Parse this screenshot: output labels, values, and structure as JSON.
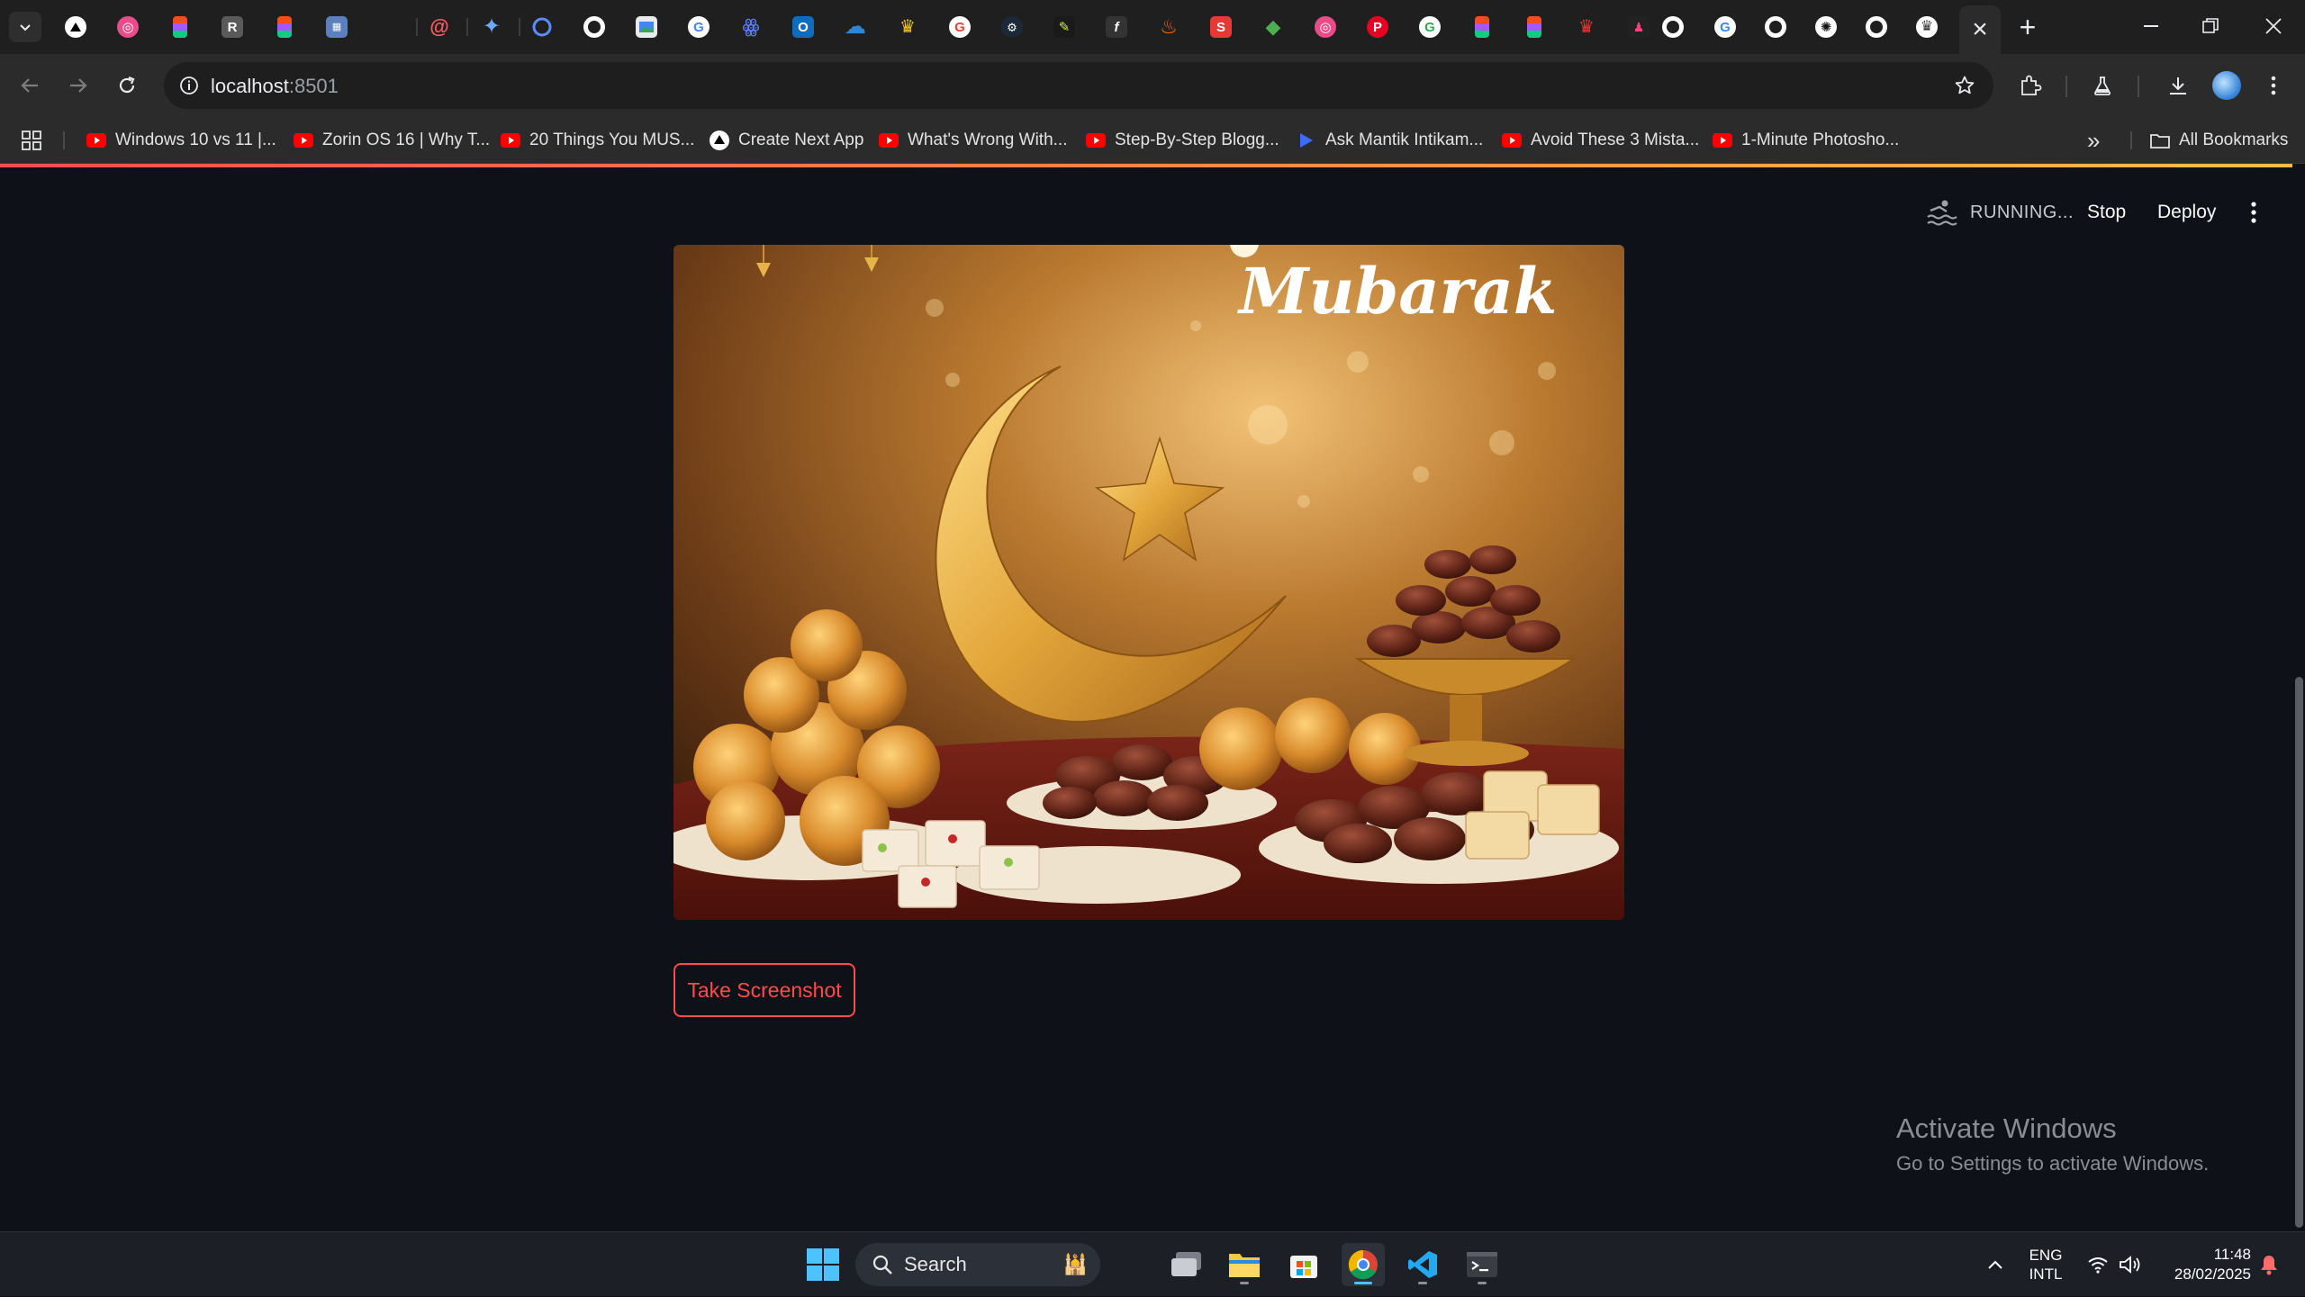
{
  "browser": {
    "active_tab_close": "×",
    "new_tab": "+",
    "url_host": "localhost",
    "url_port": ":8501"
  },
  "bookmarks": [
    {
      "label": "Windows 10 vs 11 |...",
      "icon": "youtube-icon"
    },
    {
      "label": "Zorin OS 16 | Why T...",
      "icon": "youtube-icon"
    },
    {
      "label": "20 Things You MUS...",
      "icon": "youtube-icon"
    },
    {
      "label": "Create Next App",
      "icon": "vercel-icon"
    },
    {
      "label": "What's Wrong With...",
      "icon": "youtube-icon"
    },
    {
      "label": "Step-By-Step Blogg...",
      "icon": "youtube-icon"
    },
    {
      "label": "Ask Mantik Intikam...",
      "icon": "play-icon"
    },
    {
      "label": "Avoid These 3 Mista...",
      "icon": "youtube-icon"
    },
    {
      "label": "1-Minute Photosho...",
      "icon": "youtube-icon"
    }
  ],
  "bookmarks_overflow": "»",
  "all_bookmarks": "All Bookmarks",
  "app": {
    "status": "RUNNING...",
    "stop": "Stop",
    "deploy": "Deploy",
    "hero_text": "Mubarak",
    "screenshot_button": "Take Screenshot"
  },
  "watermark": {
    "title": "Activate Windows",
    "subtitle": "Go to Settings to activate Windows."
  },
  "taskbar": {
    "search_label": "Search",
    "lang_line1": "ENG",
    "lang_line2": "INTL",
    "time": "11:48",
    "date": "28/02/2025"
  },
  "colors": {
    "streamlit_accent": "#ff4b4b",
    "app_background": "#0e1117",
    "chrome_toolbar": "#2b2b2b"
  }
}
